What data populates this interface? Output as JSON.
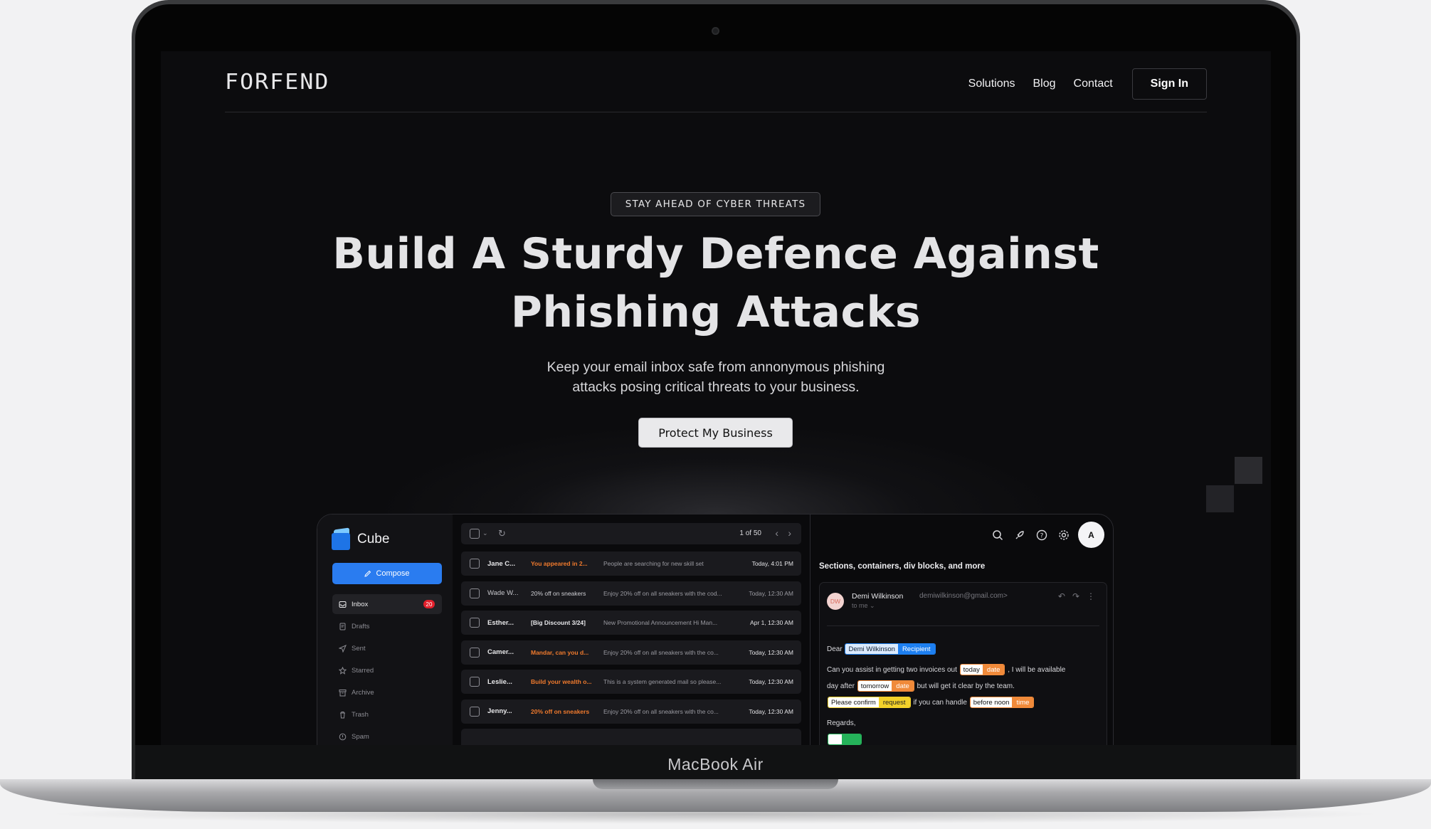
{
  "device": {
    "label": "MacBook Air"
  },
  "site": {
    "logo": "FORFEND",
    "nav": {
      "links": [
        "Solutions",
        "Blog",
        "Contact"
      ],
      "signin": "Sign In"
    },
    "hero": {
      "badge": "STAY AHEAD OF CYBER THREATS",
      "title_line1": "Build A Sturdy Defence Against",
      "title_line2": "Phishing Attacks",
      "subtitle_line1": "Keep your email inbox safe from annonymous phishing",
      "subtitle_line2": "attacks posing critical threats to your business.",
      "cta": "Protect My Business"
    }
  },
  "app": {
    "name": "Cube",
    "compose": "Compose",
    "folders": [
      {
        "label": "Inbox",
        "icon": "inbox-icon",
        "count": "20",
        "active": true
      },
      {
        "label": "Drafts",
        "icon": "draft-icon"
      },
      {
        "label": "Sent",
        "icon": "send-icon"
      },
      {
        "label": "Starred",
        "icon": "star-icon"
      },
      {
        "label": "Archive",
        "icon": "archive-icon"
      },
      {
        "label": "Trash",
        "icon": "trash-icon"
      },
      {
        "label": "Spam",
        "icon": "spam-icon"
      }
    ],
    "pagination": "1 of 50",
    "emails": [
      {
        "from": "Jane C...",
        "subject": "You appeared in 2...",
        "snippet": "People are searching for new skill set",
        "time": "Today, 4:01 PM"
      },
      {
        "from": "Wade W...",
        "subject": "20% off on sneakers",
        "snippet": "Enjoy 20% off on all sneakers with the cod...",
        "time": "Today, 12:30 AM"
      },
      {
        "from": "Esther...",
        "subject": "[Big Discount 3/24]",
        "snippet": "New Promotional Announcement Hi Man...",
        "time": "Apr 1, 12:30 AM"
      },
      {
        "from": "Camer...",
        "subject": "Mandar, can you d...",
        "snippet": "Enjoy 20% off on all sneakers with the co...",
        "time": "Today, 12:30 AM"
      },
      {
        "from": "Leslie...",
        "subject": "Build your wealth o...",
        "snippet": "This is a system generated mail so please...",
        "time": "Today, 12:30 AM"
      },
      {
        "from": "Jenny...",
        "subject": "20% off on sneakers",
        "snippet": "Enjoy 20% off on all sneakers with the co...",
        "time": "Today, 12:30 AM"
      }
    ],
    "reader": {
      "avatar": "A",
      "subject": "Sections, containers, div blocks, and more",
      "sender_initials": "DW",
      "sender_name": "Demi Wilkinson",
      "sender_email": "demiwilkinson@gmail.com>",
      "to": "to me",
      "dear": "Dear",
      "recipient_value": "Demi Wilkinson",
      "recipient_tag": "Recipient",
      "line1_text": "Can you assist in getting two invoices out",
      "chip_today": "today",
      "chip_date": "date",
      "line1_tail": ", I will be available",
      "line2_head": "day after",
      "chip_tomorrow": "tomorrow",
      "line2_tail": "but will get it clear by the team.",
      "chip_confirm": "Please confirm",
      "chip_request": "request",
      "line3_mid": "if you can handle",
      "chip_noon": "before noon",
      "chip_time": "time",
      "regards": "Regards,"
    }
  },
  "colors": {
    "accent_blue": "#2a7cf0",
    "orange": "#f07a2d",
    "unread_badge": "#e21f2b",
    "bg": "#0c0c0e"
  }
}
